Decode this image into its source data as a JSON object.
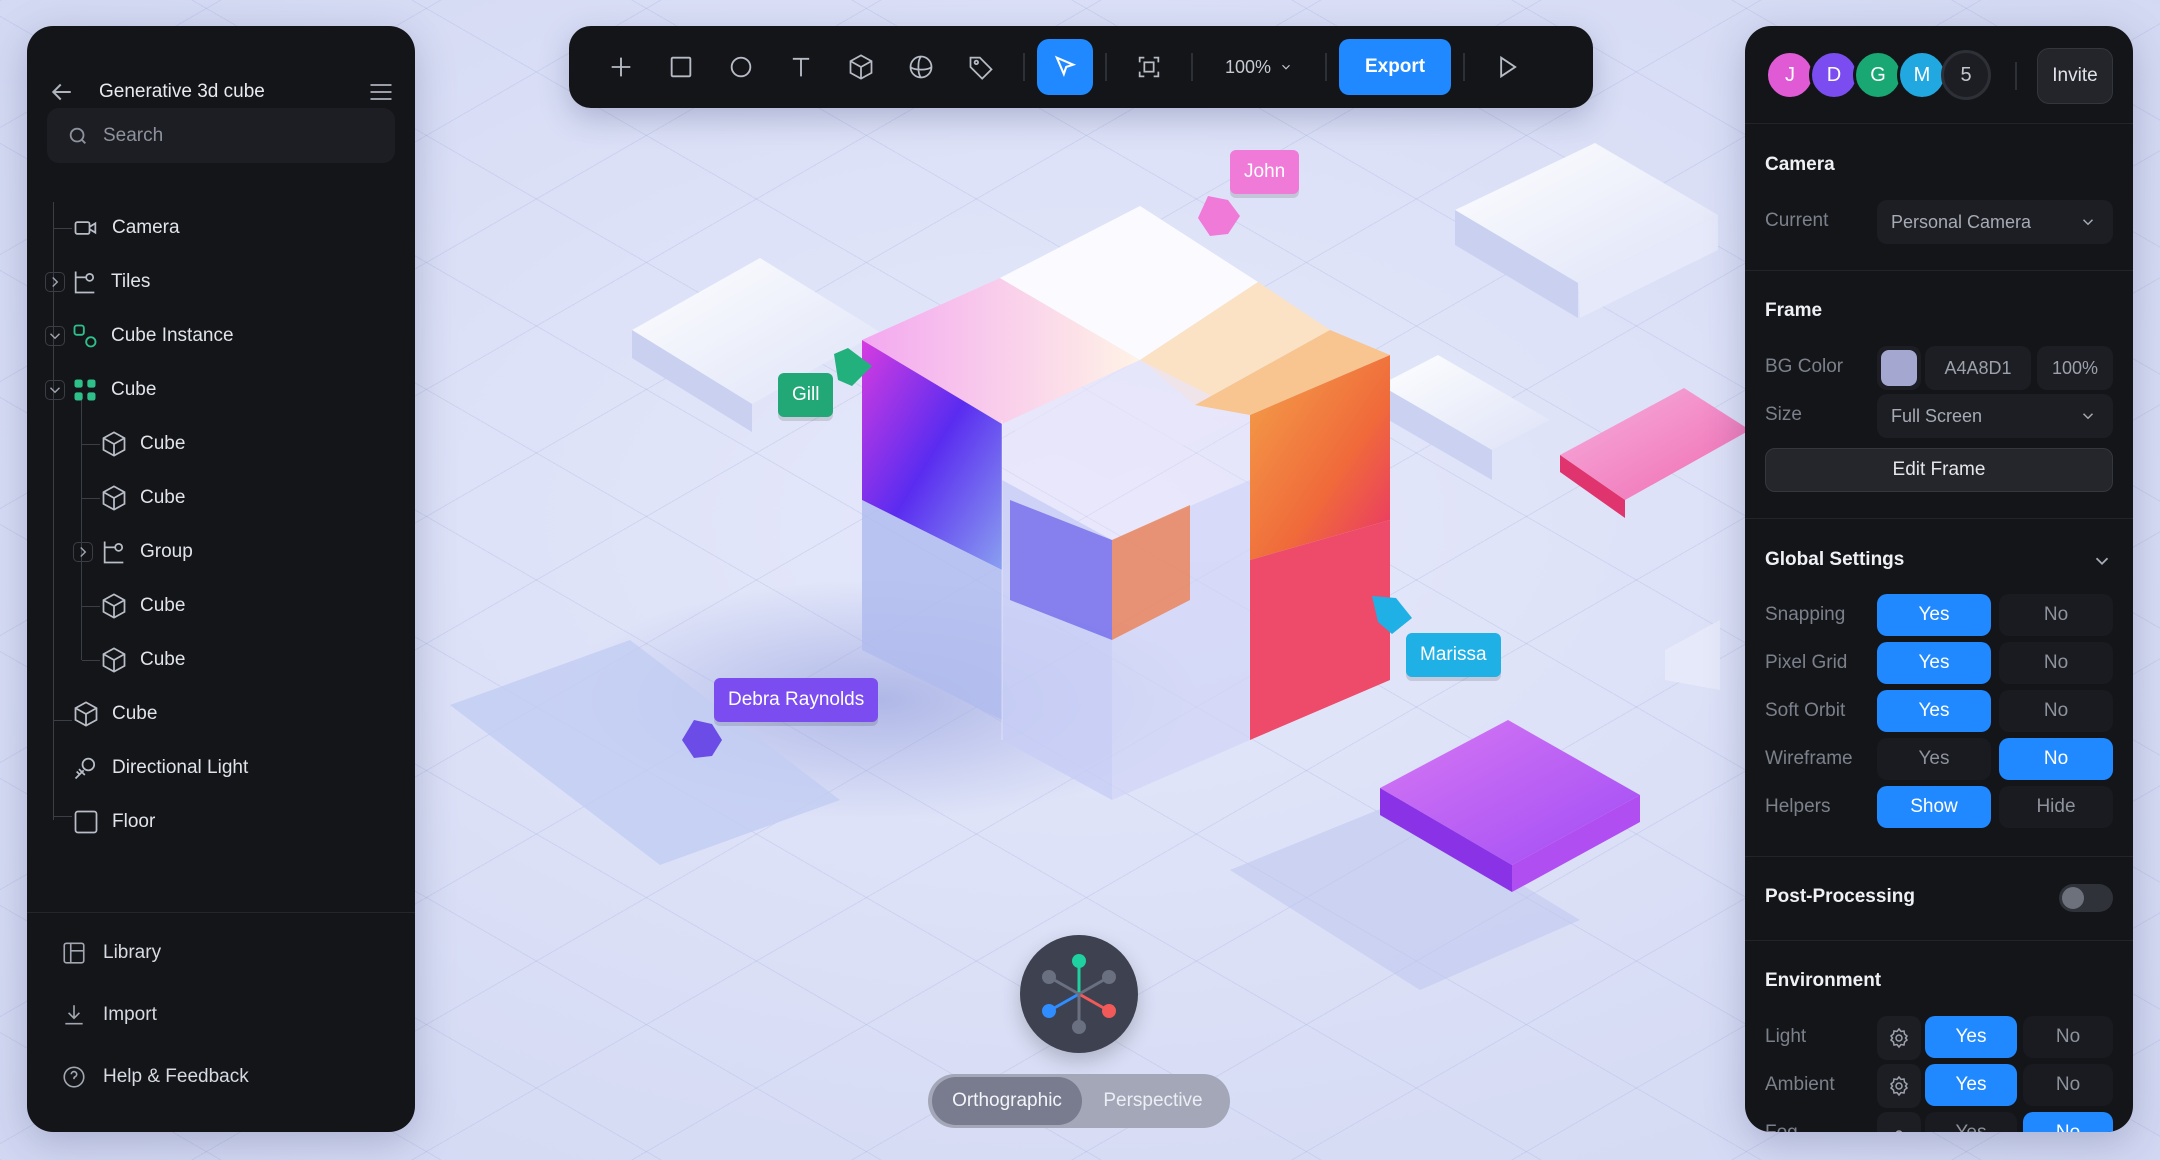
{
  "project": {
    "title": "Generative 3d cube"
  },
  "search": {
    "placeholder": "Search"
  },
  "layers": [
    {
      "label": "Camera",
      "icon": "camera-icon"
    },
    {
      "label": "Tiles",
      "icon": "group-icon"
    },
    {
      "label": "Cube Instance",
      "icon": "instance-icon"
    },
    {
      "label": "Cube",
      "icon": "component-icon"
    },
    {
      "label": "Cube",
      "icon": "cube-icon"
    },
    {
      "label": "Cube",
      "icon": "cube-icon"
    },
    {
      "label": "Group",
      "icon": "group-icon"
    },
    {
      "label": "Cube",
      "icon": "cube-icon"
    },
    {
      "label": "Cube",
      "icon": "cube-icon"
    },
    {
      "label": "Cube",
      "icon": "cube-icon"
    },
    {
      "label": "Directional Light",
      "icon": "light-icon"
    },
    {
      "label": "Floor",
      "icon": "square-icon"
    }
  ],
  "footer": {
    "library": "Library",
    "import": "Import",
    "help": "Help & Feedback"
  },
  "toolbar": {
    "zoom": "100%",
    "export": "Export"
  },
  "collaborators": {
    "avatars": [
      {
        "initial": "J",
        "color": "#e05ad6"
      },
      {
        "initial": "D",
        "color": "#7b4df0"
      },
      {
        "initial": "G",
        "color": "#19a874"
      },
      {
        "initial": "M",
        "color": "#21a8e0"
      }
    ],
    "more": "5",
    "invite": "Invite"
  },
  "camera": {
    "title": "Camera",
    "current_label": "Current",
    "current_value": "Personal Camera"
  },
  "frame": {
    "title": "Frame",
    "bg_label": "BG Color",
    "bg_color": "#A4A8D1",
    "bg_hex": "A4A8D1",
    "bg_opacity": "100%",
    "size_label": "Size",
    "size_value": "Full Screen",
    "edit": "Edit Frame"
  },
  "global": {
    "title": "Global Settings",
    "rows": [
      {
        "label": "Snapping",
        "a": "Yes",
        "b": "No",
        "sel": "a"
      },
      {
        "label": "Pixel Grid",
        "a": "Yes",
        "b": "No",
        "sel": "a"
      },
      {
        "label": "Soft Orbit",
        "a": "Yes",
        "b": "No",
        "sel": "a"
      },
      {
        "label": "Wireframe",
        "a": "Yes",
        "b": "No",
        "sel": "b"
      },
      {
        "label": "Helpers",
        "a": "Show",
        "b": "Hide",
        "sel": "a"
      }
    ]
  },
  "post": {
    "title": "Post-Processing",
    "enabled": false
  },
  "env": {
    "title": "Environment",
    "rows": [
      {
        "label": "Light",
        "a": "Yes",
        "b": "No",
        "sel": "a"
      },
      {
        "label": "Ambient",
        "a": "Yes",
        "b": "No",
        "sel": "a"
      },
      {
        "label": "Fog",
        "a": "Yes",
        "b": "No",
        "sel": "b"
      }
    ]
  },
  "cursors": {
    "john": "John",
    "gill": "Gill",
    "marissa": "Marissa",
    "debra": "Debra Raynolds"
  },
  "view": {
    "ortho": "Orthographic",
    "persp": "Perspective"
  },
  "colors": {
    "accent": "#2189ff",
    "panel": "#131519",
    "canvas": "#dfe3f8"
  }
}
